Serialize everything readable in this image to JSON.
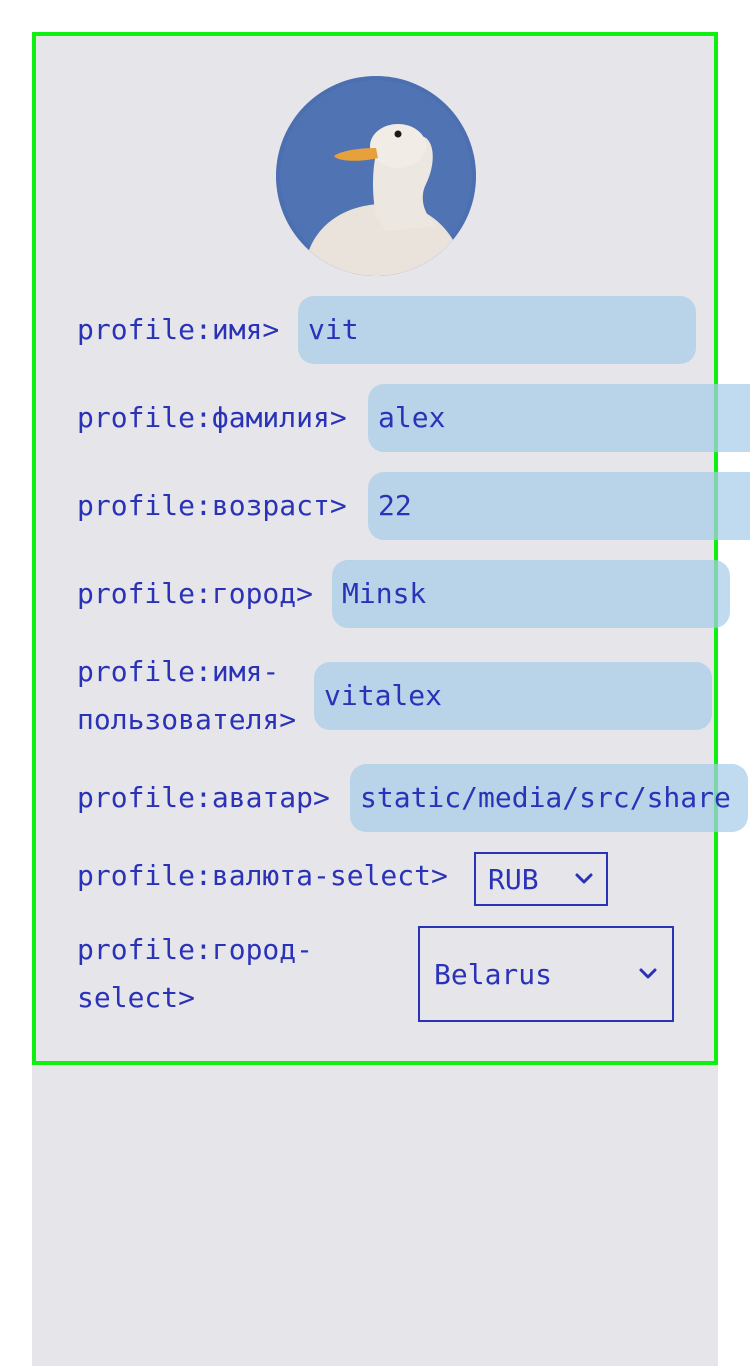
{
  "avatar": {
    "icon": "duck-avatar-icon",
    "colors": {
      "sky": "#4b6fb0",
      "bird": "#e9e3dc",
      "beak": "#e8a13a"
    }
  },
  "fields": {
    "name": {
      "label": "profile:имя>",
      "value": "vit"
    },
    "surname": {
      "label": "profile:фамилия>",
      "value": "alex"
    },
    "age": {
      "label": "profile:возраст>",
      "value": "22"
    },
    "city": {
      "label": "profile:город>",
      "value": "Minsk"
    },
    "username": {
      "label_line1": "profile:имя-",
      "label_line2": "пользователя>",
      "value": "vitalex"
    },
    "avatar_path": {
      "label": "profile:аватар>",
      "value": "static/media/src/share"
    }
  },
  "selects": {
    "currency": {
      "label": "profile:валюта-select>",
      "value": "RUB",
      "icon": "chevron-down-icon"
    },
    "country": {
      "label_line1": "profile:город-",
      "label_line2": "select>",
      "value": "Belarus",
      "icon": "chevron-down-icon"
    }
  },
  "colors": {
    "text": "#2a32b8",
    "frame": "#11ee11",
    "panel": "#e6e6ea",
    "field": "#b9d2e7"
  }
}
